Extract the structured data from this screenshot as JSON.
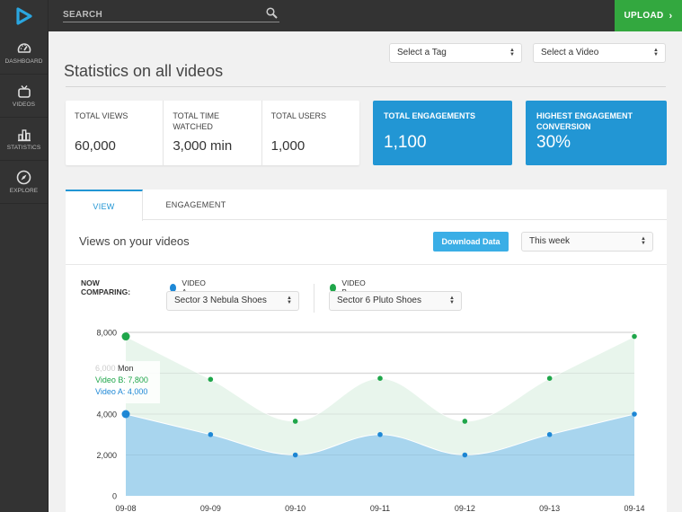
{
  "header": {
    "search_label": "SEARCH",
    "upload_label": "UPLOAD",
    "upload_chevron": "›",
    "brand_color": "#2aa6e0",
    "upload_color": "#33a83f"
  },
  "sidebar": {
    "items": [
      {
        "label": "DASHBOARD",
        "icon": "speedometer-icon"
      },
      {
        "label": "VIDEOS",
        "icon": "tv-icon"
      },
      {
        "label": "STATISTICS",
        "icon": "bar-chart-icon"
      },
      {
        "label": "EXPLORE",
        "icon": "compass-icon"
      }
    ]
  },
  "filters": {
    "tag_select": "Select a Tag",
    "video_select": "Select a Video"
  },
  "page": {
    "title": "Statistics on all videos"
  },
  "stats": [
    {
      "label": "TOTAL VIEWS",
      "value": "60,000"
    },
    {
      "label": "TOTAL TIME WATCHED",
      "value": "3,000 min"
    },
    {
      "label": "TOTAL USERS",
      "value": "1,000"
    }
  ],
  "highlight_stats": [
    {
      "label": "TOTAL ENGAGEMENTS",
      "value": "1,100"
    },
    {
      "label": "HIGHEST ENGAGEMENT CONVERSION",
      "value": "30%"
    }
  ],
  "panel": {
    "tabs": [
      {
        "label": "VIEW",
        "active": true
      },
      {
        "label": "ENGAGEMENT",
        "active": false
      }
    ],
    "section_title": "Views on your videos",
    "download_label": "Download Data",
    "range_select": "This week",
    "comparing_label": "NOW COMPARING:",
    "video_a": {
      "label": "VIDEO A",
      "selected": "Sector 3 Nebula Shoes",
      "color": "#1e88d6"
    },
    "video_b": {
      "label": "VIDEO B",
      "selected": "Sector 6 Pluto Shoes",
      "color": "#1fa64a"
    }
  },
  "tooltip": {
    "ghost_tick": "6,000",
    "day": "Mon",
    "line_b": "Video B:  7,800",
    "line_a": "Video A:  4,000"
  },
  "chart_data": {
    "type": "area",
    "title": "Views on your videos",
    "xlabel": "",
    "ylabel": "",
    "x": [
      "09-08",
      "09-09",
      "09-10",
      "09-11",
      "09-12",
      "09-13",
      "09-14"
    ],
    "yticks": [
      0,
      2000,
      4000,
      6000,
      8000
    ],
    "ytick_labels": [
      "0",
      "2,000",
      "4,000",
      "6,000",
      "8,000"
    ],
    "ylim": [
      0,
      8000
    ],
    "grid": true,
    "series": [
      {
        "name": "Video B",
        "values": [
          7800,
          5700,
          3650,
          5750,
          3650,
          5750,
          7800
        ],
        "color": "#1fa64a",
        "fill": "#e6f4ea"
      },
      {
        "name": "Video A",
        "values": [
          4000,
          3000,
          2000,
          3000,
          2000,
          3000,
          4000
        ],
        "color": "#1e88d6",
        "fill": "#a8d5ee"
      }
    ]
  }
}
